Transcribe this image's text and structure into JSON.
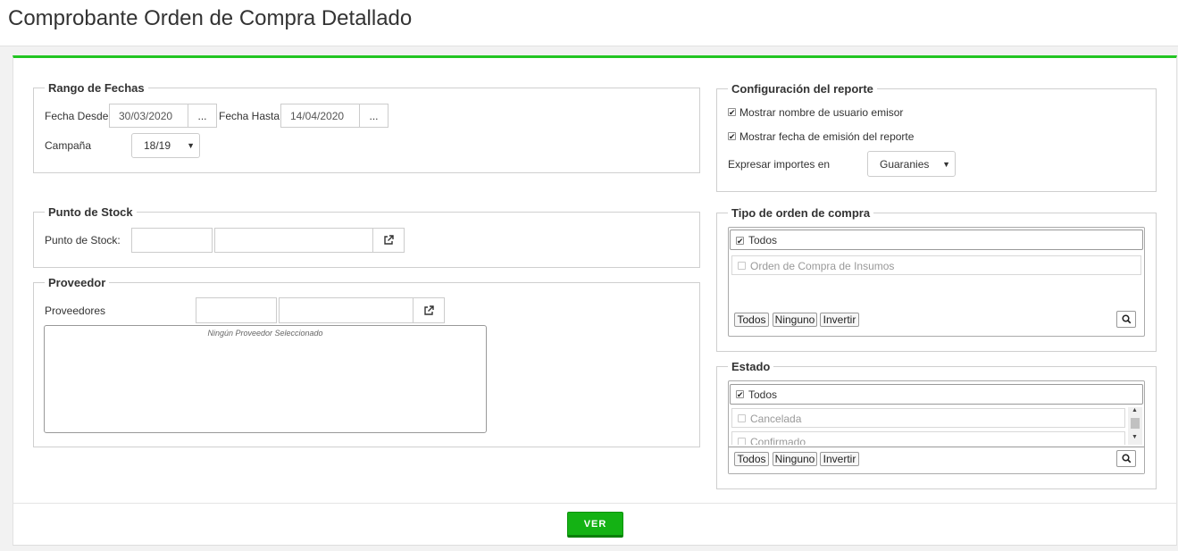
{
  "page": {
    "title": "Comprobante Orden de Compra Detallado"
  },
  "rango_fechas": {
    "legend": "Rango de Fechas",
    "fecha_desde_label": "Fecha Desde",
    "fecha_desde_value": "30/03/2020",
    "fecha_hasta_label": "Fecha Hasta",
    "fecha_hasta_value": "14/04/2020",
    "picker_label": "...",
    "campana_label": "Campaña",
    "campana_value": "18/19"
  },
  "punto_stock": {
    "legend": "Punto de Stock",
    "label": "Punto de Stock:",
    "code_value": "",
    "name_value": ""
  },
  "proveedor": {
    "legend": "Proveedor",
    "label": "Proveedores",
    "code_value": "",
    "name_value": "",
    "empty_text": "Ningún Proveedor Seleccionado"
  },
  "config": {
    "legend": "Configuración del reporte",
    "mostrar_usuario_label": "Mostrar nombre de usuario emisor",
    "mostrar_usuario_checked": true,
    "mostrar_fecha_label": "Mostrar fecha de emisión del reporte",
    "mostrar_fecha_checked": true,
    "expresar_label": "Expresar importes en",
    "moneda_value": "Guaranies"
  },
  "tipo_orden": {
    "legend": "Tipo de orden de compra",
    "todos_label": "Todos",
    "options": [
      {
        "label": "Orden de Compra de Insumos",
        "checked": false
      }
    ],
    "btn_todos": "Todos",
    "btn_ninguno": "Ninguno",
    "btn_invertir": "Invertir"
  },
  "estado": {
    "legend": "Estado",
    "todos_label": "Todos",
    "options": [
      {
        "label": "Cancelada",
        "checked": false
      },
      {
        "label": "Confirmado",
        "checked": false
      }
    ],
    "btn_todos": "Todos",
    "btn_ninguno": "Ninguno",
    "btn_invertir": "Invertir"
  },
  "footer": {
    "ver_label": "VER"
  },
  "icons": {
    "check": "✔",
    "external_link": "external-link-icon",
    "search": "search-icon"
  },
  "colors": {
    "accent": "#22c522",
    "button_green": "#14b214"
  }
}
